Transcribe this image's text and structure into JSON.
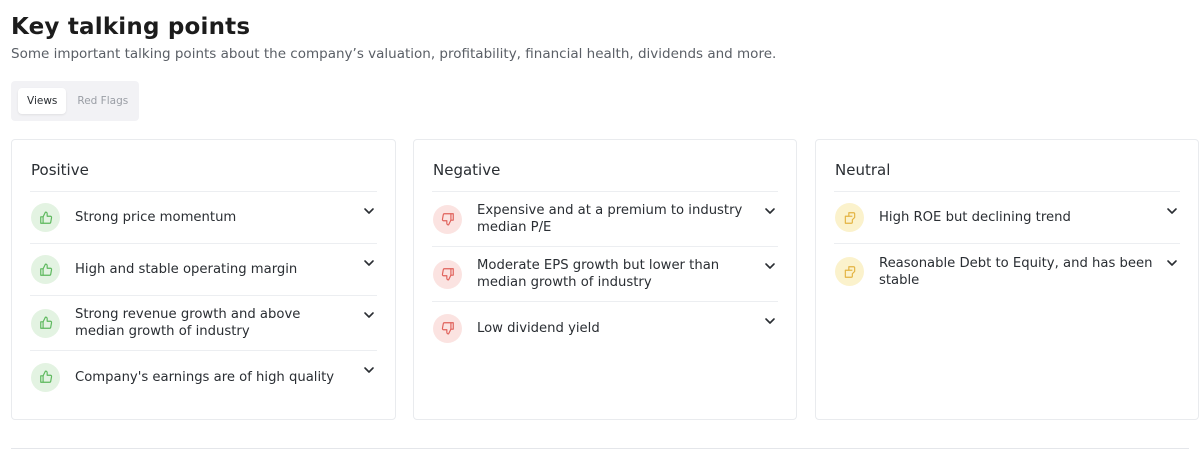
{
  "header": {
    "title": "Key talking points",
    "subtitle": "Some important talking points about the company’s valuation, profitability, financial health, dividends and more."
  },
  "tabs": [
    {
      "label": "Views",
      "active": true
    },
    {
      "label": "Red Flags",
      "active": false
    }
  ],
  "colors": {
    "positive_icon_bg": "#e3f3e2",
    "positive_icon": "#5cb85c",
    "negative_icon_bg": "#fbe3e1",
    "negative_icon": "#e0605a",
    "neutral_icon_bg": "#fbf2cc",
    "neutral_icon": "#e3b341"
  },
  "cards": {
    "positive": {
      "title": "Positive",
      "items": [
        {
          "text": "Strong price momentum",
          "icon": "thumbs-up-icon"
        },
        {
          "text": "High and stable operating margin",
          "icon": "thumbs-up-icon"
        },
        {
          "text": "Strong revenue growth and above median growth of industry",
          "icon": "thumbs-up-icon"
        },
        {
          "text": "Company's earnings are of high quality",
          "icon": "thumbs-up-icon"
        }
      ]
    },
    "negative": {
      "title": "Negative",
      "items": [
        {
          "text": "Expensive and at a premium to industry median P/E",
          "icon": "thumbs-down-icon"
        },
        {
          "text": "Moderate EPS growth but lower than median growth of industry",
          "icon": "thumbs-down-icon"
        },
        {
          "text": "Low dividend yield",
          "icon": "thumbs-down-icon"
        }
      ]
    },
    "neutral": {
      "title": "Neutral",
      "items": [
        {
          "text": "High ROE but declining trend",
          "icon": "thumbs-sideways-icon"
        },
        {
          "text": "Reasonable Debt to Equity, and has been stable",
          "icon": "thumbs-sideways-icon"
        }
      ]
    }
  }
}
